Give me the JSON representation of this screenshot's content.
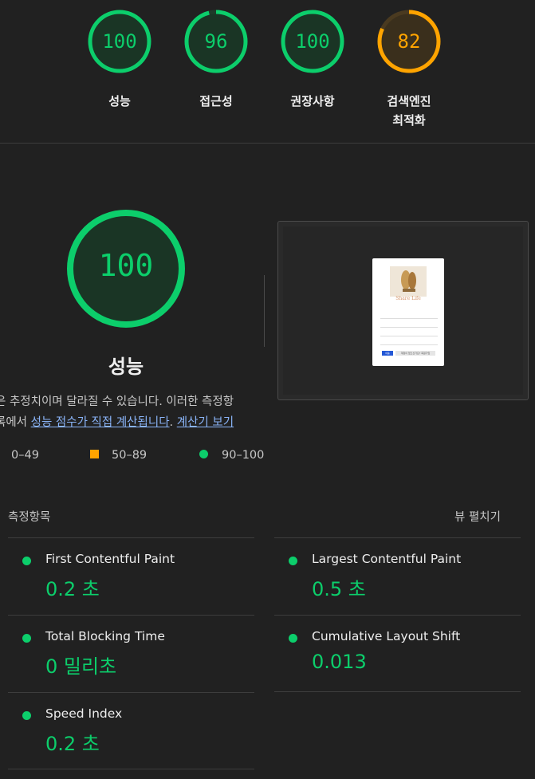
{
  "colors": {
    "pass": "#0cce6b",
    "average": "#ffa400",
    "background": "#212121",
    "link": "#8ab4f8"
  },
  "categories": [
    {
      "label": "성능",
      "score": 100,
      "status": "pass"
    },
    {
      "label": "접근성",
      "score": 96,
      "status": "pass"
    },
    {
      "label": "권장사항",
      "score": 100,
      "status": "pass"
    },
    {
      "label_line1": "검색엔진",
      "label_line2": "최적화",
      "score": 82,
      "status": "average"
    }
  ],
  "performance": {
    "score": 100,
    "title": "성능",
    "desc_line1": "은 추정치이며 달라질 수 있습니다. 이러한 측정항",
    "desc_line2_prefix": "록에서 ",
    "desc_link1": "성능 점수가 직접 계산됩니다",
    "desc_sep": ". ",
    "desc_link2": "계산기 보기"
  },
  "legend": {
    "fail": "0–49",
    "average": "50–89",
    "pass": "90–100"
  },
  "preview": {
    "app_name": "Share Life",
    "button1": "이동",
    "button2": "계정이 없으신가요? 회원가입"
  },
  "metrics": {
    "header": "측정항목",
    "expand": "뷰 펼치기",
    "items": [
      {
        "title": "First Contentful Paint",
        "value": "0.2 초"
      },
      {
        "title": "Largest Contentful Paint",
        "value": "0.5 초"
      },
      {
        "title": "Total Blocking Time",
        "value": "0 밀리초"
      },
      {
        "title": "Cumulative Layout Shift",
        "value": "0.013"
      },
      {
        "title": "Speed Index",
        "value": "0.2 초"
      }
    ]
  }
}
